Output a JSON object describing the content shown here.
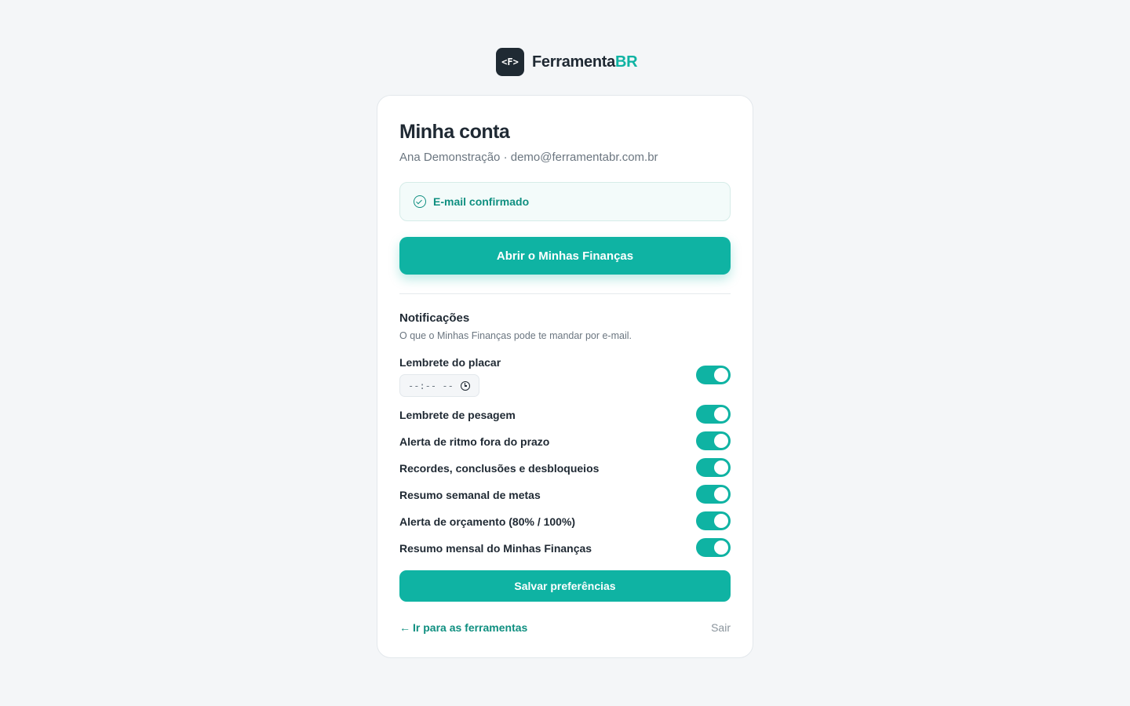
{
  "brand": {
    "logo_text": "<F>",
    "name_main": "Ferramenta",
    "name_accent": "BR"
  },
  "account": {
    "title": "Minha conta",
    "subtitle": "Ana Demonstração · demo@ferramentabr.com.br",
    "email_status": "E-mail confirmado",
    "open_app_label": "Abrir o Minhas Finanças"
  },
  "notifications": {
    "title": "Notificações",
    "description": "O que o Minhas Finanças pode te mandar por e-mail.",
    "time_placeholder": "--:-- --",
    "items": [
      {
        "label": "Lembrete do placar",
        "enabled": true
      },
      {
        "label": "Lembrete de pesagem",
        "enabled": true
      },
      {
        "label": "Alerta de ritmo fora do prazo",
        "enabled": true
      },
      {
        "label": "Recordes, conclusões e desbloqueios",
        "enabled": true
      },
      {
        "label": "Resumo semanal de metas",
        "enabled": true
      },
      {
        "label": "Alerta de orçamento (80% / 100%)",
        "enabled": true
      },
      {
        "label": "Resumo mensal do Minhas Finanças",
        "enabled": true
      }
    ],
    "save_label": "Salvar preferências"
  },
  "footer": {
    "back_arrow": "←",
    "back_label": "Ir para as ferramentas",
    "logout_label": "Sair"
  },
  "colors": {
    "accent": "#0fb3a3",
    "accent_dark": "#0f8f80",
    "logo_bg": "#1f2a33"
  }
}
